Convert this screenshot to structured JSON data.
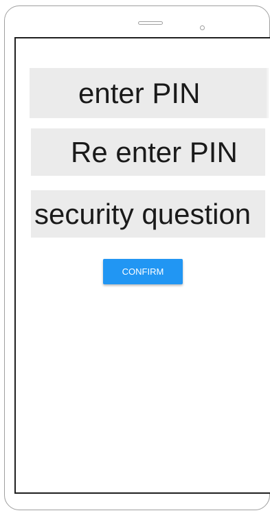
{
  "form": {
    "pin_field_text": "enter PIN",
    "repin_field_text": "Re enter PIN",
    "question_field_text": "security question",
    "confirm_label": "CONFIRM"
  },
  "colors": {
    "field_background": "#ebebeb",
    "button_primary": "#2196f3",
    "button_text": "#ffffff",
    "screen_border": "#1f1f1f",
    "device_outline": "#9e9e9e"
  },
  "icons": {
    "speaker": "speaker-slot-icon",
    "camera": "front-camera-icon"
  }
}
